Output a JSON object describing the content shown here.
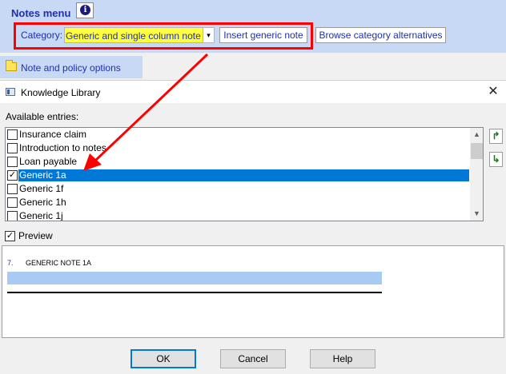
{
  "notes_bar": {
    "title": "Notes menu",
    "info_icon": "info-icon",
    "category_label": "Category:",
    "category_value": "Generic and single column note",
    "insert_button": "Insert generic note",
    "browse_button": "Browse category alternatives"
  },
  "note_policy": {
    "label": "Note and policy options",
    "icon": "folder-icon"
  },
  "dialog": {
    "title": "Knowledge Library",
    "available_label": "Available entries:",
    "entries": [
      {
        "label": "Insurance claim",
        "checked": false,
        "selected": false
      },
      {
        "label": "Introduction to notes",
        "checked": false,
        "selected": false
      },
      {
        "label": "Loan payable",
        "checked": false,
        "selected": false
      },
      {
        "label": "Generic 1a",
        "checked": true,
        "selected": true
      },
      {
        "label": "Generic 1f",
        "checked": false,
        "selected": false
      },
      {
        "label": "Generic 1h",
        "checked": false,
        "selected": false
      },
      {
        "label": "Generic 1j",
        "checked": false,
        "selected": false
      }
    ],
    "preview_label": "Preview",
    "preview_checked": true,
    "preview_number": "7.",
    "preview_title": "GENERIC NOTE 1A",
    "ok_button": "OK",
    "cancel_button": "Cancel",
    "help_button": "Help"
  },
  "colors": {
    "header_bg": "#c7d9f5",
    "link_blue": "#1f2fb0",
    "highlight_yellow": "#ffff3b",
    "annotation_red": "#ff0000",
    "selection_blue": "#0078d7"
  }
}
